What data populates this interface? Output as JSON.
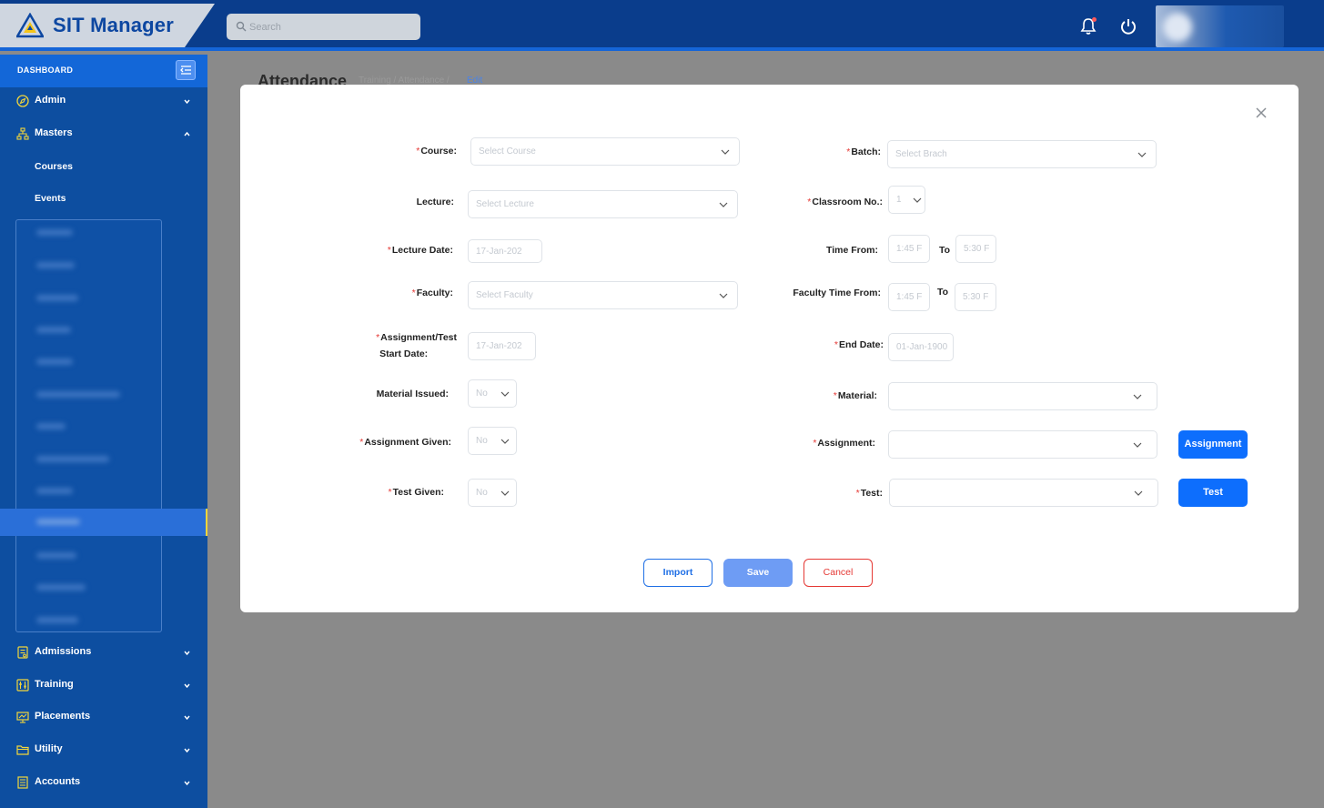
{
  "app": {
    "name": "SIT Manager"
  },
  "search": {
    "placeholder": "Search"
  },
  "sidebar": {
    "dashboard_label": "DASHBOARD",
    "items": [
      {
        "label": "Admin",
        "icon": "compass-icon"
      },
      {
        "label": "Masters",
        "icon": "sitemap-icon"
      },
      {
        "label": "Admissions",
        "icon": "form-icon"
      },
      {
        "label": "Training",
        "icon": "sliders-icon"
      },
      {
        "label": "Placements",
        "icon": "presentation-icon"
      },
      {
        "label": "Utility",
        "icon": "folder-icon"
      },
      {
        "label": "Accounts",
        "icon": "ledger-icon"
      }
    ],
    "masters_sub": [
      "Courses",
      "Events"
    ]
  },
  "page": {
    "title": "Attendance",
    "breadcrumb": "Training / Attendance /",
    "breadcrumb_current": "Edit"
  },
  "form": {
    "course": {
      "label": "Course:",
      "placeholder": "Select Course"
    },
    "batch": {
      "label": "Batch:",
      "placeholder": "Select Brach"
    },
    "lecture": {
      "label": "Lecture:",
      "placeholder": "Select Lecture"
    },
    "classroom": {
      "label": "Classroom No.:",
      "value": "1"
    },
    "lecture_date": {
      "label": "Lecture Date:",
      "value": "17-Jan-202"
    },
    "time_from": {
      "label": "Time From:",
      "from": "1:45 F",
      "to_label": "To",
      "to": "5:30 F"
    },
    "faculty": {
      "label": "Faculty:",
      "placeholder": "Select Faculty"
    },
    "faculty_time": {
      "label": "Faculty Time From:",
      "from": "1:45 F",
      "to_label": "To",
      "to": "5:30 F"
    },
    "assign_start": {
      "label_line1": "Assignment/Test",
      "label_line2": "Start Date:",
      "value": "17-Jan-202"
    },
    "end_date": {
      "label": "End Date:",
      "value": "01-Jan-1900"
    },
    "material_issued": {
      "label": "Material Issued:",
      "value": "No"
    },
    "material": {
      "label": "Material:"
    },
    "assignment_given": {
      "label": "Assignment Given:",
      "value": "No"
    },
    "assignment": {
      "label": "Assignment:",
      "button": "Assignment"
    },
    "test_given": {
      "label": "Test Given:",
      "value": "No"
    },
    "test": {
      "label": "Test:",
      "button": "Test"
    }
  },
  "footer": {
    "import": "Import",
    "save": "Save",
    "cancel": "Cancel"
  },
  "colors": {
    "primary": "#0d6efd",
    "nav": "#0d4ea0",
    "topbar": "#0a3d8c",
    "danger": "#e53935"
  }
}
